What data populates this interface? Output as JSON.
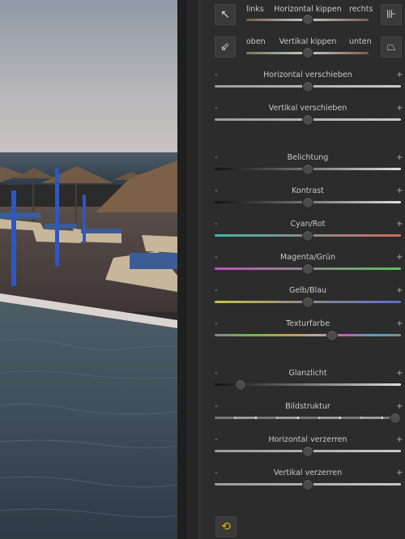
{
  "tilt": [
    {
      "left_label": "links",
      "title": "Horizontal kippen",
      "right_label": "rechts",
      "left_icon": "↖",
      "right_icon": "⊪",
      "value": 0.5
    },
    {
      "left_label": "oben",
      "title": "Vertikal kippen",
      "right_label": "unten",
      "left_icon": "⇙",
      "right_icon": "⏢",
      "value": 0.5
    }
  ],
  "sliders": [
    {
      "label": "Horizontal verschieben",
      "minus": "-",
      "plus": "+",
      "value": 0.5,
      "track": "gray"
    },
    {
      "label": "Vertikal verschieben",
      "minus": "-",
      "plus": "+",
      "value": 0.5,
      "track": "gray"
    },
    {
      "label": "Belichtung",
      "minus": "-",
      "plus": "+",
      "value": 0.5,
      "track": "dark-light"
    },
    {
      "label": "Kontrast",
      "minus": "-",
      "plus": "+",
      "value": 0.5,
      "track": "dark-light"
    },
    {
      "label": "Cyan/Rot",
      "minus": "-",
      "plus": "+",
      "value": 0.5,
      "track": "cyan-red"
    },
    {
      "label": "Magenta/Grün",
      "minus": "-",
      "plus": "+",
      "value": 0.5,
      "track": "magenta-green"
    },
    {
      "label": "Gelb/Blau",
      "minus": "-",
      "plus": "+",
      "value": 0.5,
      "track": "yellow-blue"
    },
    {
      "label": "Texturfarbe",
      "minus": "-",
      "plus": "+",
      "value": 0.63,
      "track": "spectrum"
    },
    {
      "label": "Glanzlicht",
      "minus": "-",
      "plus": "+",
      "value": 0.14,
      "track": "dark-light"
    },
    {
      "label": "Bildstruktur",
      "minus": "-",
      "plus": "+",
      "value": 0.97,
      "track": "segmented"
    },
    {
      "label": "Horizontal verzerren",
      "minus": "-",
      "plus": "+",
      "value": 0.5,
      "track": "gray"
    },
    {
      "label": "Vertikal verzerren",
      "minus": "-",
      "plus": "+",
      "value": 0.5,
      "track": "gray"
    }
  ],
  "reset_icon": "⟲",
  "colors": {
    "panel": "#2c2c2c",
    "text": "#c9c9c9",
    "reset": "#e6b800"
  }
}
